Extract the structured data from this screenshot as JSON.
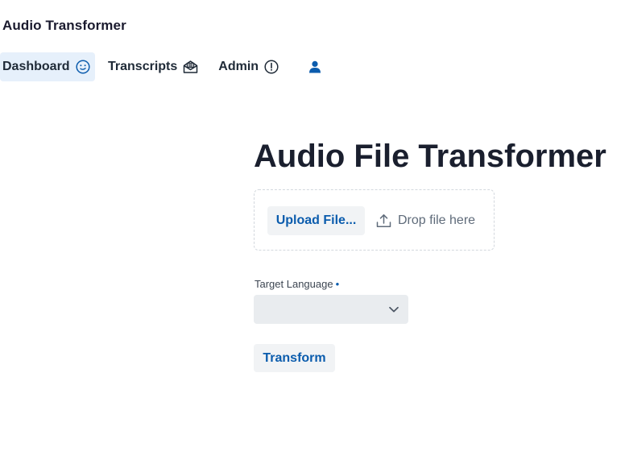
{
  "app": {
    "title": "Audio Transformer"
  },
  "nav": {
    "items": [
      {
        "label": "Dashboard",
        "icon": "smile-face-icon",
        "active": true
      },
      {
        "label": "Transcripts",
        "icon": "open-envelope-icon",
        "active": false
      },
      {
        "label": "Admin",
        "icon": "alert-circle-icon",
        "active": false
      },
      {
        "label": "",
        "icon": "user-icon",
        "active": false
      }
    ]
  },
  "main": {
    "title": "Audio File Transformer",
    "upload": {
      "button_label": "Upload File...",
      "drop_hint": "Drop file here"
    },
    "target_language": {
      "label": "Target Language",
      "required_marker": "•",
      "value": ""
    },
    "transform_label": "Transform"
  },
  "colors": {
    "accent": "#0b5cad",
    "nav_active_bg": "#e6f0fb",
    "button_bg": "#f1f3f5",
    "select_bg": "#e9ecef"
  }
}
